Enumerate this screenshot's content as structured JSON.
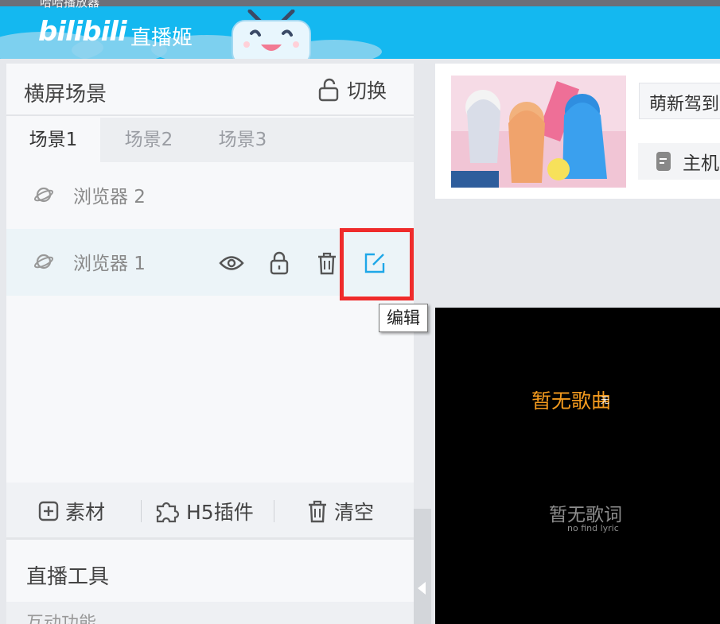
{
  "header": {
    "ghost_title": "哈哈播放器",
    "logo": "bilibili",
    "app_name": "直播姬"
  },
  "scene_panel": {
    "title": "横屏场景",
    "switch_label": "切换",
    "tabs": [
      {
        "label": "场景1",
        "active": true
      },
      {
        "label": "场景2",
        "active": false
      },
      {
        "label": "场景3",
        "active": false
      }
    ],
    "sources": [
      {
        "label": "浏览器 2",
        "selected": false
      },
      {
        "label": "浏览器 1",
        "selected": true
      }
    ],
    "source_actions": [
      "eye-icon",
      "lock-icon",
      "trash-icon",
      "edit-icon"
    ],
    "edit_tooltip": "编辑",
    "bottom_actions": [
      {
        "label": "素材",
        "icon": "plus-square-icon"
      },
      {
        "label": "H5插件",
        "icon": "puzzle-icon"
      },
      {
        "label": "清空",
        "icon": "trash-icon"
      }
    ],
    "tools_title": "直播工具",
    "tools_sub": "互动功能"
  },
  "room": {
    "title_value": "萌新驾到",
    "host_label": "主机"
  },
  "preview": {
    "song": "暂无歌曲",
    "song_sub": "无",
    "lyric": "暂无歌词",
    "lyric_sub": "no find lyric"
  },
  "colors": {
    "header_bg": "#14b8f0",
    "highlight": "#ef2b2b",
    "song": "#f39a1e",
    "edit_icon": "#1ea7e8"
  }
}
